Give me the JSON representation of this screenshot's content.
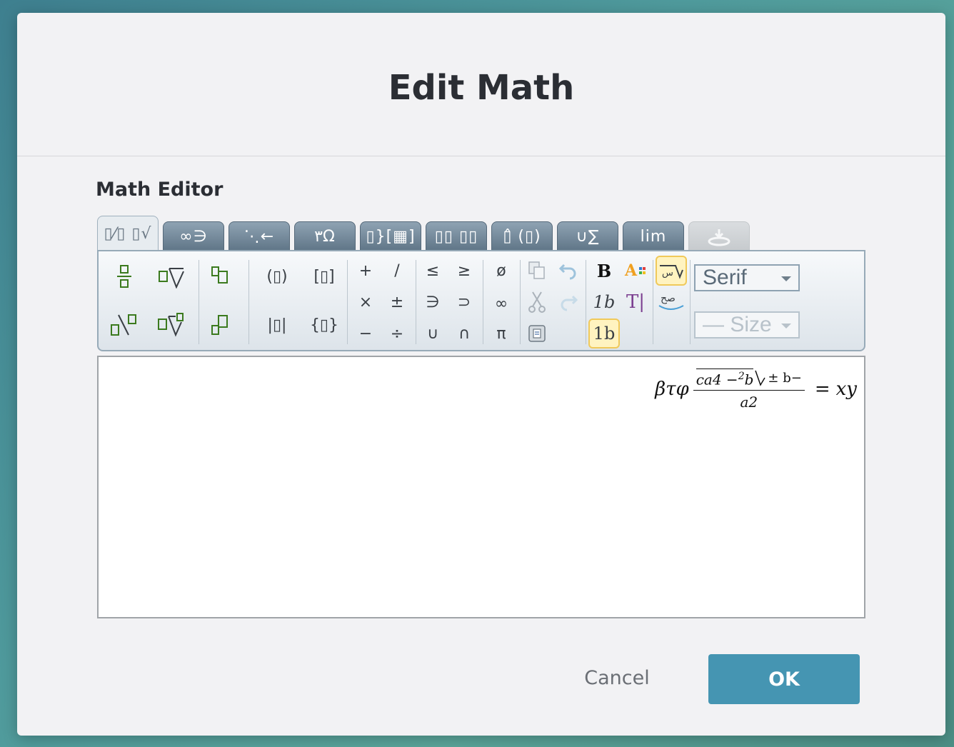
{
  "dialog": {
    "title": "Edit Math",
    "section_label": "Math Editor",
    "cancel_label": "Cancel",
    "ok_label": "OK",
    "accent_color": "#4595b2"
  },
  "tabs": [
    {
      "label": "▯⁄▯ ▯√",
      "active": true
    },
    {
      "label": "∞∋",
      "active": false
    },
    {
      "label": "⋱←",
      "active": false
    },
    {
      "label": "٣Ω",
      "active": false
    },
    {
      "label": "▯}[▦]",
      "active": false
    },
    {
      "label": "▯▯ ▯▯",
      "active": false
    },
    {
      "label": "▯̂ (▯)",
      "active": false
    },
    {
      "label": "∪∑",
      "active": false
    },
    {
      "label": "lim",
      "active": false
    },
    {
      "label": "",
      "active": false,
      "disabled": true
    }
  ],
  "toolbar": {
    "font_select": "Serif",
    "size_select": "— Size",
    "symbols": {
      "plus": "+",
      "slash": "/",
      "leq": "≤",
      "geq": "≥",
      "emptyset": "ø",
      "times": "×",
      "plusminus": "±",
      "ni": "∋",
      "supset": "⊃",
      "infinity": "∞",
      "minus": "−",
      "divide": "÷",
      "cup": "∪",
      "cap": "∩",
      "pi": "π",
      "paren": "(▯)",
      "bracket": "[▯]",
      "abs": "|▯|",
      "brace": "{▯}",
      "bold": "B",
      "italic_1b": "1b",
      "text_cursor": "T|",
      "selected_1b": "1b"
    }
  },
  "editor": {
    "lhs": "βτφ",
    "numerator_main": "ca4 −",
    "numerator_sup": "2",
    "numerator_b": "b",
    "numerator_tail": "± b−",
    "denominator": "a2",
    "equals": "=",
    "rhs": "xy"
  }
}
